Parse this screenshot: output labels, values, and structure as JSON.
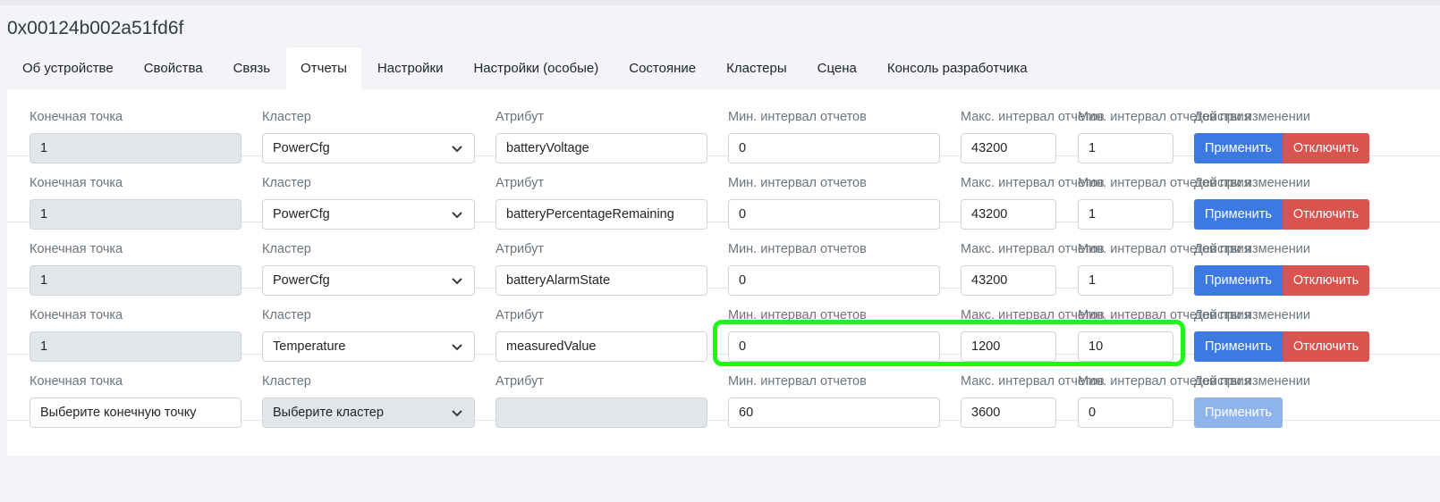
{
  "device_title": "0x00124b002a51fd6f",
  "tabs": [
    {
      "label": "Об устройстве"
    },
    {
      "label": "Свойства"
    },
    {
      "label": "Связь"
    },
    {
      "label": "Отчеты",
      "active": true
    },
    {
      "label": "Настройки"
    },
    {
      "label": "Настройки (особые)"
    },
    {
      "label": "Состояние"
    },
    {
      "label": "Кластеры"
    },
    {
      "label": "Сцена"
    },
    {
      "label": "Консоль разработчика"
    }
  ],
  "labels": {
    "endpoint": "Конечная точка",
    "cluster": "Кластер",
    "attribute": "Атрибут",
    "min_interval": "Мин. интервал отчетов",
    "max_interval": "Макс. интервал отчетов",
    "min_change": "Мин. интервал отчетов при изменении",
    "actions": "Действия"
  },
  "buttons": {
    "apply": "Применить",
    "disable": "Отключить"
  },
  "rows": [
    {
      "endpoint": "1",
      "cluster": "PowerCfg",
      "attribute": "batteryVoltage",
      "min_interval": "0",
      "max_interval": "43200",
      "min_change": "1"
    },
    {
      "endpoint": "1",
      "cluster": "PowerCfg",
      "attribute": "batteryPercentageRemaining",
      "min_interval": "0",
      "max_interval": "43200",
      "min_change": "1"
    },
    {
      "endpoint": "1",
      "cluster": "PowerCfg",
      "attribute": "batteryAlarmState",
      "min_interval": "0",
      "max_interval": "43200",
      "min_change": "1"
    },
    {
      "endpoint": "1",
      "cluster": "Temperature",
      "attribute": "measuredValue",
      "min_interval": "0",
      "max_interval": "1200",
      "min_change": "10"
    }
  ],
  "new_row": {
    "endpoint_placeholder": "Выберите конечную точку",
    "cluster_placeholder": "Выберите кластер",
    "attribute": "",
    "min_interval": "60",
    "max_interval": "3600",
    "min_change": "0"
  },
  "colors": {
    "apply": "#3c7ae2",
    "apply_disabled": "#8fb4ec",
    "disable": "#d9534f",
    "highlight": "#22f51c",
    "disabled_field": "#e2e6eb"
  }
}
